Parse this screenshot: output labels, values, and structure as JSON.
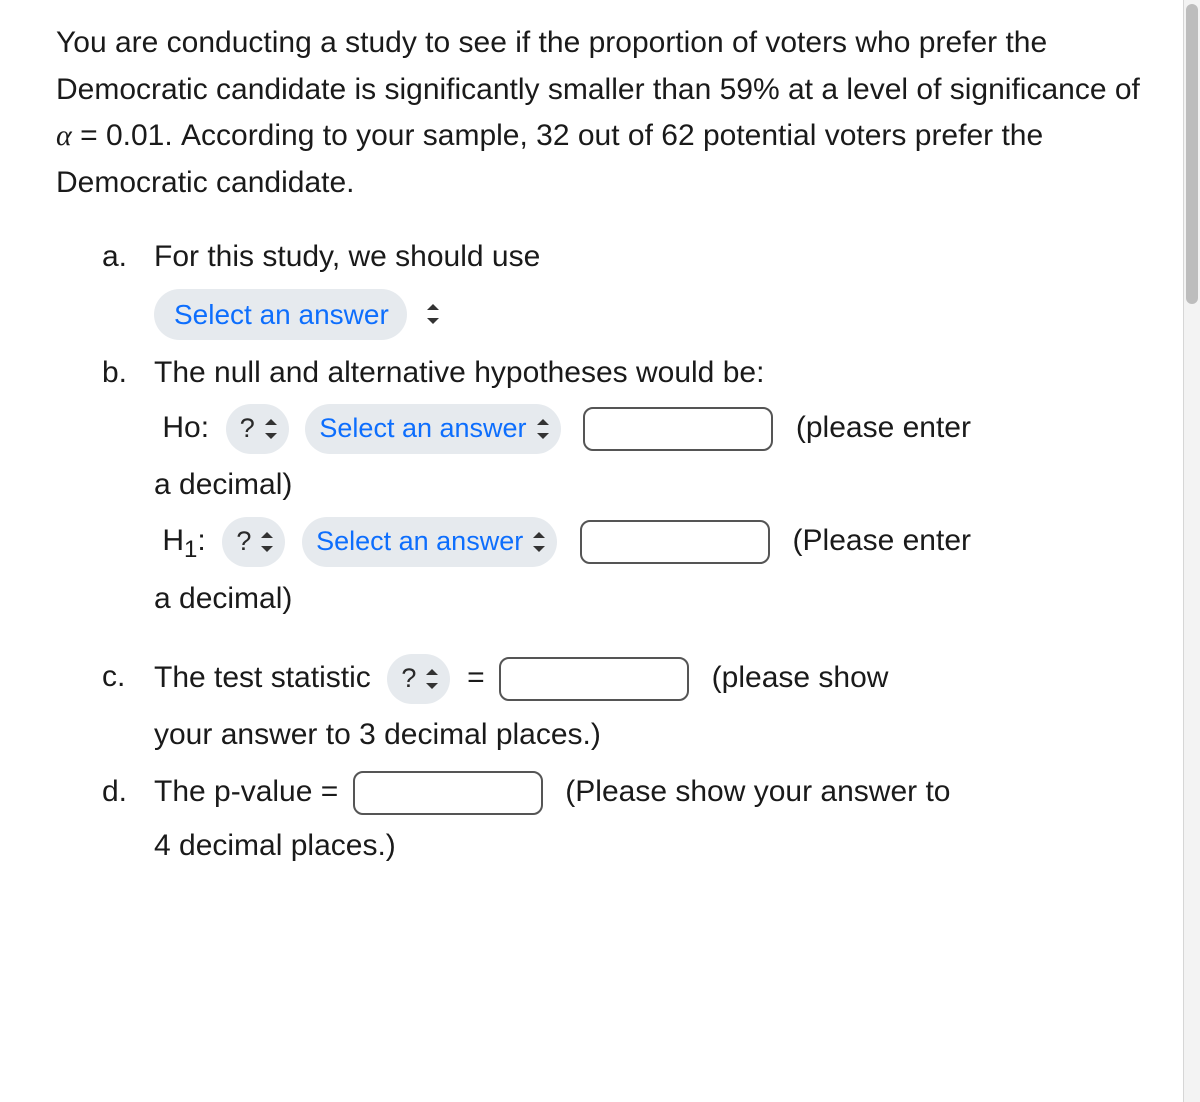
{
  "intro": {
    "text": "You are conducting a study to see if the proportion of voters who prefer the Democratic candidate is significantly smaller than 59% at a level of significance of α = 0.01. According to your sample, 32 out of 62 potential voters prefer the Democratic candidate."
  },
  "items": {
    "a": {
      "marker": "a.",
      "text": "For this study, we should use",
      "select_label": "Select an answer"
    },
    "b": {
      "marker": "b.",
      "text": "The null and alternative hypotheses would be:",
      "ho_label": "Ho:",
      "h1_label_pre": "H",
      "h1_label_sub": "1",
      "h1_label_post": ":",
      "param_select": "?",
      "op_select": "Select an answer",
      "ho_tail": "(please enter a decimal)",
      "h1_tail": "(Please enter a decimal)"
    },
    "c": {
      "marker": "c.",
      "text_pre": "The test statistic",
      "stat_select": "?",
      "equals": "=",
      "tail": "(please show your answer to 3 decimal places.)"
    },
    "d": {
      "marker": "d.",
      "text_pre": "The p-value =",
      "tail": "(Please show your answer to 4 decimal places.)"
    }
  }
}
